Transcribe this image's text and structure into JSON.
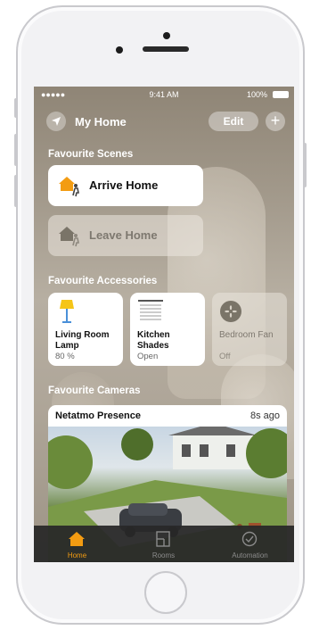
{
  "status_bar": {
    "signal": "●●●●● ",
    "time": "9:41 AM",
    "battery": "100%"
  },
  "header": {
    "home_name": "My Home",
    "edit_label": "Edit",
    "add_label": "+"
  },
  "scenes": {
    "heading": "Favourite Scenes",
    "items": [
      {
        "label": "Arrive Home",
        "icon": "arrive-home-icon"
      },
      {
        "label": "Leave Home",
        "icon": "leave-home-icon"
      }
    ]
  },
  "accessories": {
    "heading": "Favourite Accessories",
    "items": [
      {
        "name": "Living Room Lamp",
        "state": "80 %",
        "icon": "lamp-icon"
      },
      {
        "name": "Kitchen Shades",
        "state": "Open",
        "icon": "shades-icon"
      },
      {
        "name": "Bedroom Fan",
        "state": "Off",
        "icon": "fan-icon"
      }
    ]
  },
  "cameras": {
    "heading": "Favourite Cameras",
    "items": [
      {
        "name": "Netatmo Presence",
        "ago": "8s ago"
      }
    ]
  },
  "tabs": [
    {
      "label": "Home",
      "icon": "home-icon"
    },
    {
      "label": "Rooms",
      "icon": "rooms-icon"
    },
    {
      "label": "Automation",
      "icon": "automation-icon"
    }
  ],
  "colors": {
    "accent": "#f39c12",
    "tabbar_bg": "#282828"
  }
}
